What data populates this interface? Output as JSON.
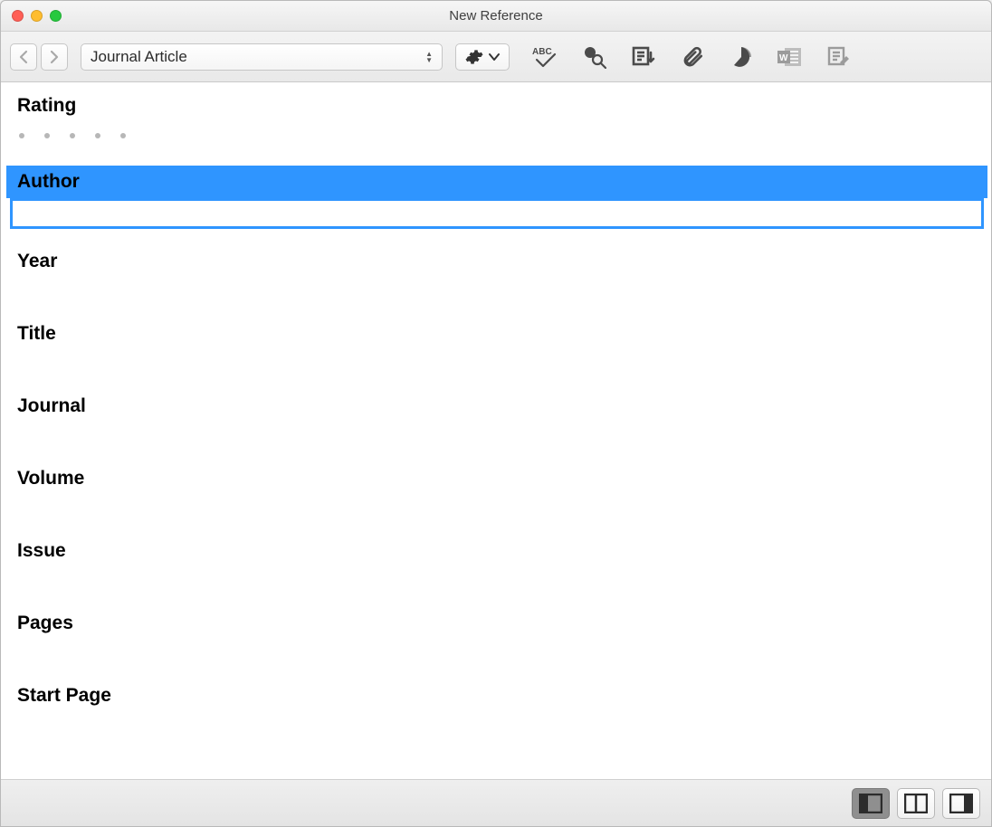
{
  "window": {
    "title": "New Reference"
  },
  "toolbar": {
    "reference_type": "Journal Article"
  },
  "fields": {
    "rating": {
      "label": "Rating"
    },
    "author": {
      "label": "Author",
      "value": ""
    },
    "year": {
      "label": "Year",
      "value": ""
    },
    "title": {
      "label": "Title",
      "value": ""
    },
    "journal": {
      "label": "Journal",
      "value": ""
    },
    "volume": {
      "label": "Volume",
      "value": ""
    },
    "issue": {
      "label": "Issue",
      "value": ""
    },
    "pages": {
      "label": "Pages",
      "value": ""
    },
    "startpage": {
      "label": "Start Page",
      "value": ""
    }
  }
}
